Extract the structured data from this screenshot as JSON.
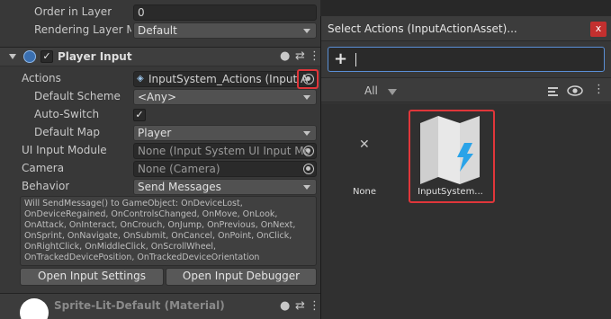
{
  "inspector": {
    "top_rows": [
      {
        "label": "Order in Layer",
        "value": "0"
      },
      {
        "label": "Rendering Layer Ma",
        "value": "Default"
      }
    ],
    "component": {
      "title": "Player Input",
      "enabled": true,
      "fields": {
        "actions": {
          "label": "Actions",
          "value": "InputSystem_Actions (Input A"
        },
        "default_scheme": {
          "label": "Default Scheme",
          "value": "<Any>"
        },
        "auto_switch": {
          "label": "Auto-Switch",
          "checked": true
        },
        "default_map": {
          "label": "Default Map",
          "value": "Player"
        },
        "ui_input_module": {
          "label": "UI Input Module",
          "value": "None (Input System UI Input Mo"
        },
        "camera": {
          "label": "Camera",
          "value": "None (Camera)"
        },
        "behavior": {
          "label": "Behavior",
          "value": "Send Messages"
        }
      },
      "help_text": "Will SendMessage() to GameObject: OnDeviceLost, OnDeviceRegained, OnControlsChanged, OnMove, OnLook, OnAttack, OnInteract, OnCrouch, OnJump, OnPrevious, OnNext, OnSprint, OnNavigate, OnSubmit, OnCancel, OnPoint, OnClick, OnRightClick, OnMiddleClick, OnScrollWheel, OnTrackedDevicePosition, OnTrackedDeviceOrientation",
      "buttons": {
        "open_settings": "Open Input Settings",
        "open_debugger": "Open Input Debugger"
      }
    },
    "next_component": {
      "title": "Sprite-Lit-Default (Material)"
    }
  },
  "picker": {
    "title": "Select Actions (InputActionAsset)...",
    "search_value": "",
    "filter_label": "All",
    "items": [
      {
        "label": "None",
        "icon": "none-x-icon"
      },
      {
        "label": "InputSystem...",
        "icon": "input-action-asset-icon"
      }
    ]
  },
  "colors": {
    "highlight": "#e0363a",
    "asset_accent": "#2aa3e8"
  }
}
